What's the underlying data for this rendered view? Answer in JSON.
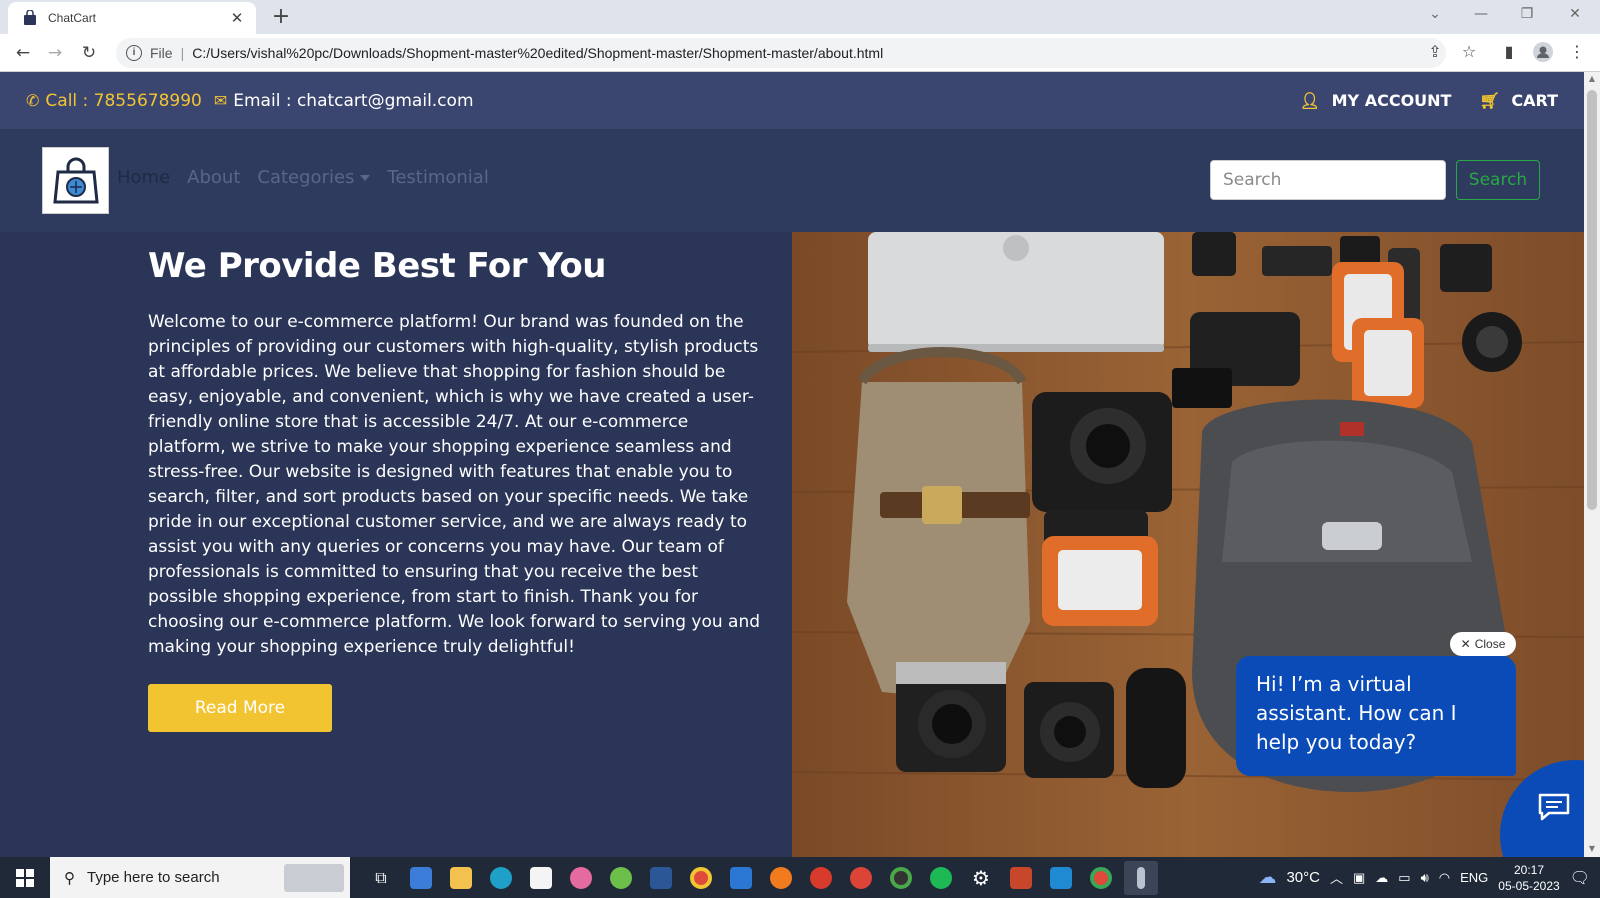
{
  "browser": {
    "tab_title": "ChatCart",
    "url_prefix": "File",
    "url_path": "C:/Users/vishal%20pc/Downloads/Shopment-master%20edited/Shopment-master/Shopment-master/about.html"
  },
  "topbar": {
    "call": "Call : 7855678990",
    "email": "Email : chatcart@gmail.com",
    "account": "MY ACCOUNT",
    "cart": "CART"
  },
  "nav": {
    "links": [
      "Home",
      "About",
      "Categories",
      "Testimonial"
    ],
    "search_placeholder": "Search",
    "search_button": "Search"
  },
  "hero": {
    "title": "We Provide Best For You",
    "body": "Welcome to our e-commerce platform! Our brand was founded on the principles of providing our customers with high-quality, stylish products at affordable prices. We believe that shopping for fashion should be easy, enjoyable, and convenient, which is why we have created a user-friendly online store that is accessible 24/7. At our e-commerce platform, we strive to make your shopping experience seamless and stress-free. Our website is designed with features that enable you to search, filter, and sort products based on your specific needs. We take pride in our exceptional customer service, and we are always ready to assist you with any queries or concerns you may have. Our team of professionals is committed to ensuring that you receive the best possible shopping experience, from start to finish. Thank you for choosing our e-commerce platform. We look forward to serving you and making your shopping experience truly delightful!",
    "button": "Read More"
  },
  "chat": {
    "close_label": "Close",
    "message": "Hi! I’m a virtual assistant. How can I help you today?"
  },
  "taskbar": {
    "search_placeholder": "Type here to search",
    "weather": "30°C",
    "language": "ENG",
    "time": "20:17",
    "date": "05-05-2023"
  },
  "colors": {
    "accent_yellow": "#f3c431",
    "page_bg": "#2b3557",
    "topbar_bg": "#3b4670",
    "chat_blue": "#0b4bb7",
    "search_green": "#28a745"
  }
}
